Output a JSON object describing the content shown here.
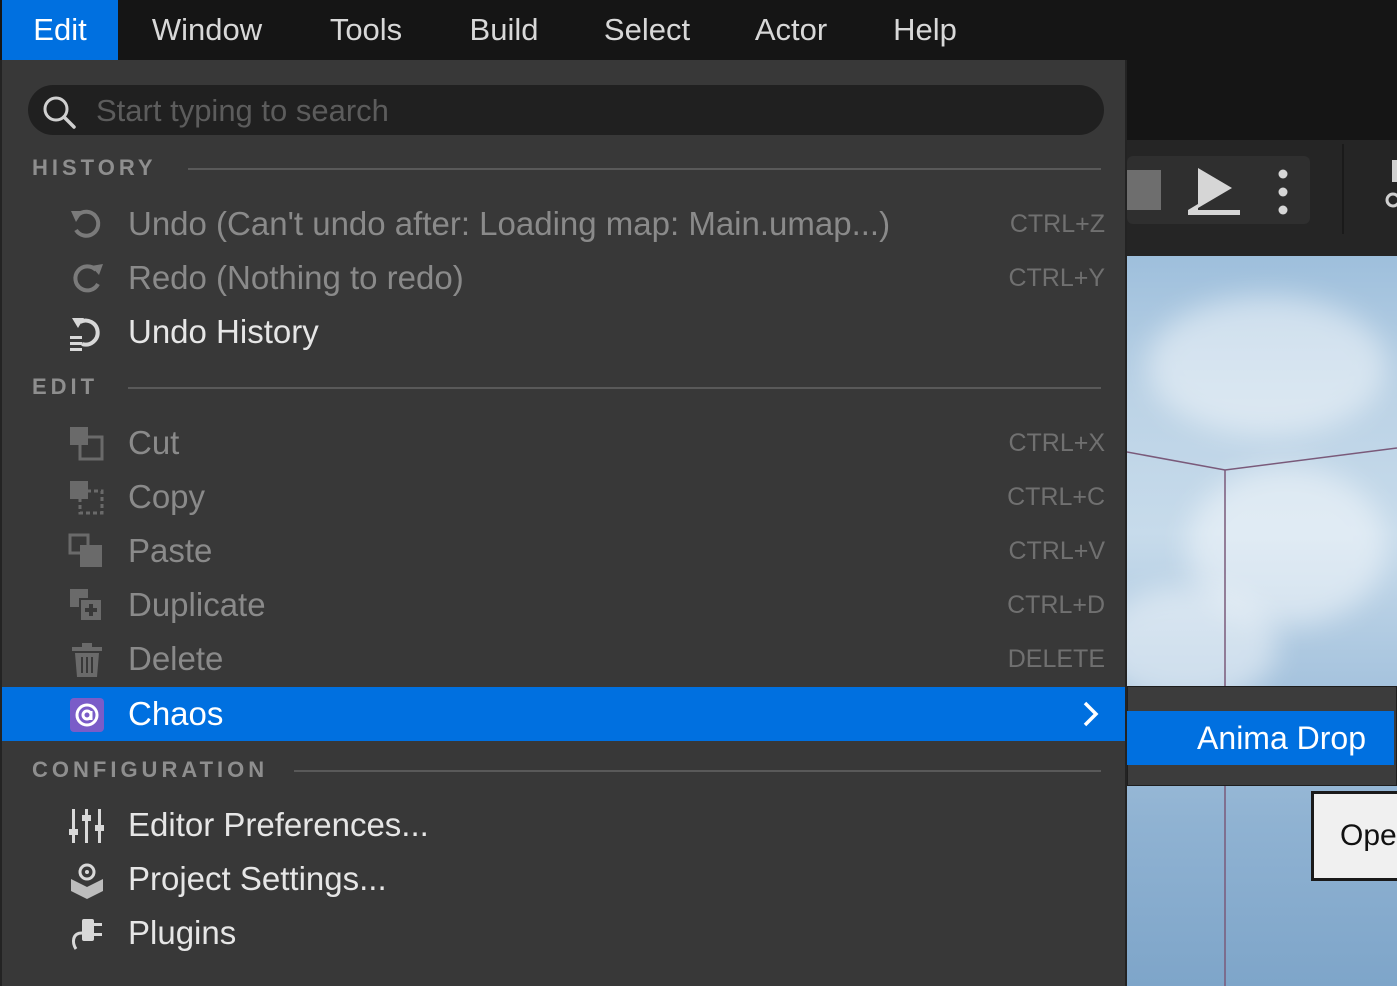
{
  "menubar": {
    "items": [
      {
        "label": "Edit",
        "active": true
      },
      {
        "label": "Window"
      },
      {
        "label": "Tools"
      },
      {
        "label": "Build"
      },
      {
        "label": "Select"
      },
      {
        "label": "Actor"
      },
      {
        "label": "Help"
      }
    ]
  },
  "dropdown": {
    "search": {
      "placeholder": "Start typing to search",
      "value": "",
      "icon": "search-icon"
    },
    "sections": {
      "history": "HISTORY",
      "edit": "EDIT",
      "configuration": "CONFIGURATION"
    },
    "items": {
      "undo": {
        "label": "Undo (Can't undo after: Loading map: Main.umap...)",
        "shortcut": "CTRL+Z",
        "icon": "undo-icon",
        "enabled": false
      },
      "redo": {
        "label": "Redo (Nothing to redo)",
        "shortcut": "CTRL+Y",
        "icon": "redo-icon",
        "enabled": false
      },
      "undo_history": {
        "label": "Undo History",
        "icon": "undo-history-icon",
        "enabled": true
      },
      "cut": {
        "label": "Cut",
        "shortcut": "CTRL+X",
        "icon": "cut-icon",
        "enabled": false
      },
      "copy": {
        "label": "Copy",
        "shortcut": "CTRL+C",
        "icon": "copy-icon",
        "enabled": false
      },
      "paste": {
        "label": "Paste",
        "shortcut": "CTRL+V",
        "icon": "paste-icon",
        "enabled": false
      },
      "duplicate": {
        "label": "Duplicate",
        "shortcut": "CTRL+D",
        "icon": "duplicate-icon",
        "enabled": false
      },
      "delete": {
        "label": "Delete",
        "shortcut": "DELETE",
        "icon": "trash-icon",
        "enabled": false
      },
      "chaos": {
        "label": "Chaos",
        "icon": "chaos-icon",
        "highlighted": true,
        "has_submenu": true
      },
      "editor_preferences": {
        "label": "Editor Preferences...",
        "icon": "sliders-icon",
        "enabled": true
      },
      "project_settings": {
        "label": "Project Settings...",
        "icon": "project-settings-icon",
        "enabled": true
      },
      "plugins": {
        "label": "Plugins",
        "icon": "plugin-icon",
        "enabled": true
      }
    }
  },
  "submenu": {
    "items": [
      {
        "label": "Anima Drop",
        "highlighted": true
      }
    ]
  },
  "background": {
    "open_button_label": "Oper"
  },
  "colors": {
    "accent": "#0070e0",
    "menu_bg": "#383838",
    "menubar_bg": "#151515",
    "disabled_text": "#8a8a8a",
    "shortcut_text": "#707070"
  }
}
